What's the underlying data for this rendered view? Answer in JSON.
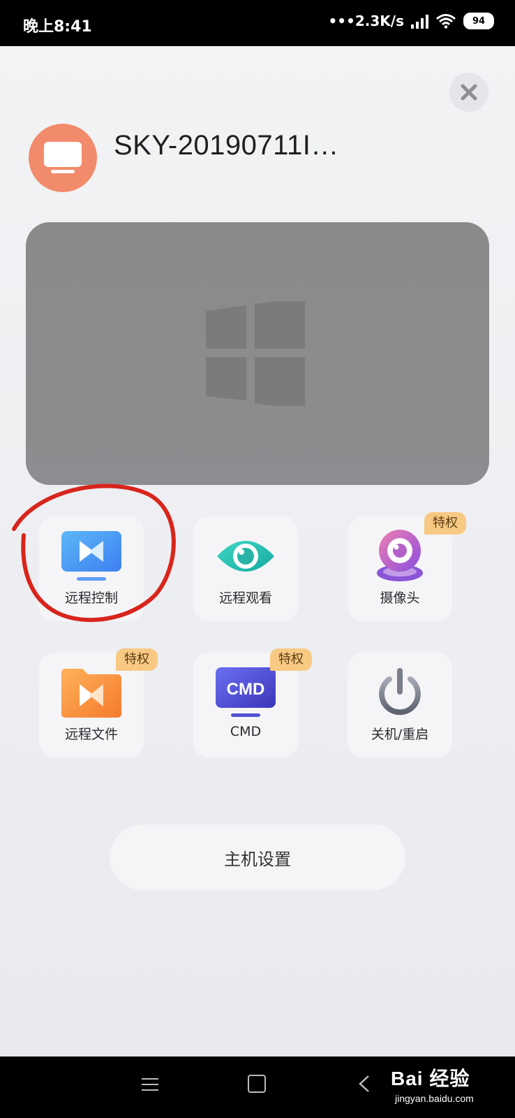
{
  "status_bar": {
    "time": "晚上8:41",
    "network_speed": "•••2.3K/s",
    "battery": "94"
  },
  "host": {
    "name": "SKY-20190711I…",
    "avatar_color": "#f28b6c"
  },
  "actions": [
    {
      "label": "远程控制",
      "icon": "remote-control-icon",
      "badge": ""
    },
    {
      "label": "远程观看",
      "icon": "eye-icon",
      "badge": ""
    },
    {
      "label": "摄像头",
      "icon": "camera-icon",
      "badge": "特权"
    },
    {
      "label": "远程文件",
      "icon": "folder-icon",
      "badge": "特权"
    },
    {
      "label": "CMD",
      "icon": "cmd-icon",
      "icon_text": "CMD",
      "badge": "特权"
    },
    {
      "label": "关机/重启",
      "icon": "power-icon",
      "badge": ""
    }
  ],
  "host_settings_label": "主机设置",
  "watermark": {
    "main": "Bai 经验",
    "sub": "jingyan.baidu.com"
  },
  "colors": {
    "annotation_red": "#d8251c",
    "badge_bg": "#f8c983",
    "preview_bg": "#8a8a8a"
  }
}
